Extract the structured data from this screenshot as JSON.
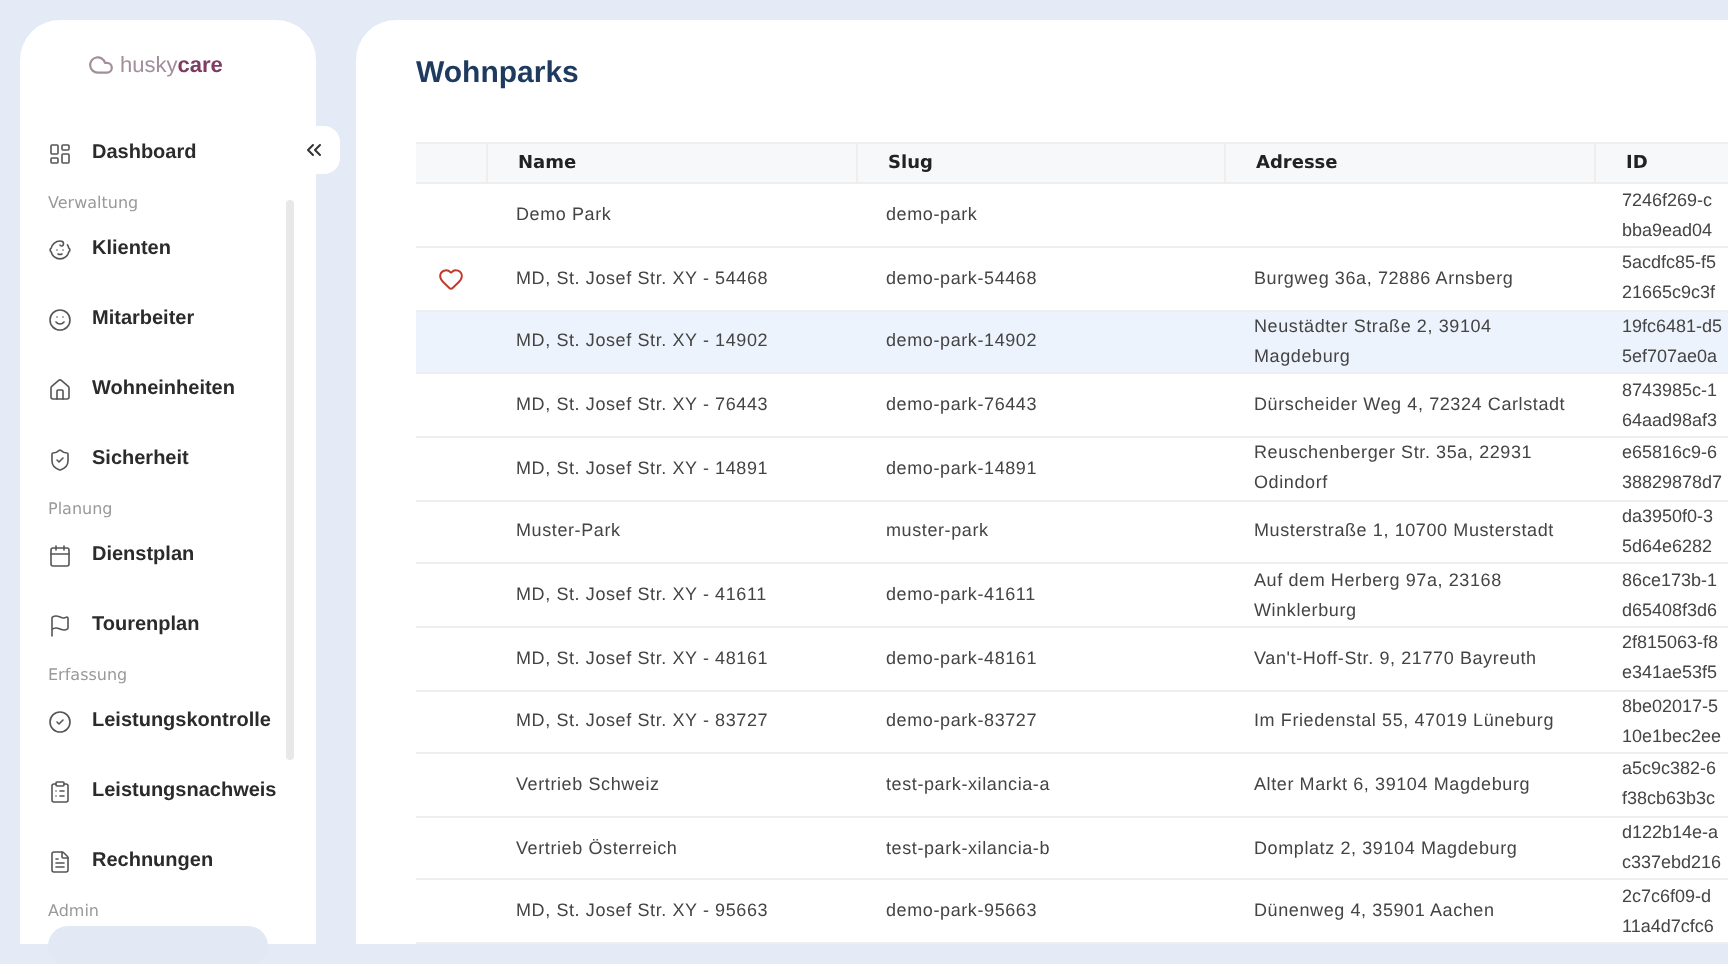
{
  "logo": {
    "text_light": "husky",
    "text_bold": "care"
  },
  "sidebar": {
    "items": [
      {
        "kind": "item",
        "label": "Dashboard",
        "selected": false
      },
      {
        "kind": "section",
        "label": "Verwaltung"
      },
      {
        "kind": "item",
        "label": "Klienten",
        "selected": false
      },
      {
        "kind": "item",
        "label": "Mitarbeiter",
        "selected": false
      },
      {
        "kind": "item",
        "label": "Wohneinheiten",
        "selected": false
      },
      {
        "kind": "item",
        "label": "Sicherheit",
        "selected": false
      },
      {
        "kind": "section",
        "label": "Planung"
      },
      {
        "kind": "item",
        "label": "Dienstplan",
        "selected": false
      },
      {
        "kind": "item",
        "label": "Tourenplan",
        "selected": false
      },
      {
        "kind": "section",
        "label": "Erfassung"
      },
      {
        "kind": "item",
        "label": "Leistungskontrolle",
        "selected": false
      },
      {
        "kind": "item",
        "label": "Leistungsnachweis",
        "selected": false
      },
      {
        "kind": "item",
        "label": "Rechnungen",
        "selected": false
      },
      {
        "kind": "section",
        "label": "Admin"
      },
      {
        "kind": "item",
        "selected": true
      }
    ]
  },
  "page_title": "Wohnparks",
  "table": {
    "columns": [
      "Name",
      "Slug",
      "Adresse",
      "ID"
    ],
    "rows": [
      {
        "favorite": false,
        "selected": false,
        "name": "Demo Park",
        "slug": "demo-park",
        "id": [
          "7246f269-c",
          "bba9ead04"
        ]
      },
      {
        "favorite": true,
        "selected": false,
        "name": "MD, St. Josef Str. XY - 54468",
        "slug": "demo-park-54468",
        "address": "Burgweg 36a, 72886 Arnsberg",
        "id": [
          "5acdfc85-f5",
          "21665c9c3f"
        ]
      },
      {
        "favorite": false,
        "selected": true,
        "name": "MD, St. Josef Str. XY - 14902",
        "slug": "demo-park-14902",
        "address": "Neustädter Straße 2, 39104 Magdeburg",
        "id": [
          "19fc6481-d5",
          "5ef707ae0a"
        ]
      },
      {
        "favorite": false,
        "selected": false,
        "name": "MD, St. Josef Str. XY - 76443",
        "slug": "demo-park-76443",
        "address": "Dürscheider Weg 4, 72324 Carlstadt",
        "id": [
          "8743985c-1",
          "64aad98af3"
        ]
      },
      {
        "favorite": false,
        "selected": false,
        "name": "MD, St. Josef Str. XY - 14891",
        "slug": "demo-park-14891",
        "address": "Reuschenberger Str. 35a, 22931 Odindorf",
        "id": [
          "e65816c9-6",
          "38829878d7"
        ]
      },
      {
        "favorite": false,
        "selected": false,
        "name": "Muster-Park",
        "slug": "muster-park",
        "address": "Musterstraße 1, 10700 Musterstadt",
        "id": [
          "da3950f0-3",
          "5d64e6282"
        ]
      },
      {
        "favorite": false,
        "selected": false,
        "name": "MD, St. Josef Str. XY - 41611",
        "slug": "demo-park-41611",
        "address": "Auf dem Herberg 97a, 23168 Winklerburg",
        "id": [
          "86ce173b-1",
          "d65408f3d6"
        ]
      },
      {
        "favorite": false,
        "selected": false,
        "name": "MD, St. Josef Str. XY - 48161",
        "slug": "demo-park-48161",
        "address": "Van't-Hoff-Str. 9, 21770 Bayreuth",
        "id": [
          "2f815063-f8",
          "e341ae53f5"
        ]
      },
      {
        "favorite": false,
        "selected": false,
        "name": "MD, St. Josef Str. XY - 83727",
        "slug": "demo-park-83727",
        "address": "Im Friedenstal 55, 47019 Lüneburg",
        "id": [
          "8be02017-5",
          "10e1bec2ee"
        ]
      },
      {
        "favorite": false,
        "selected": false,
        "name": "Vertrieb Schweiz",
        "slug": "test-park-xilancia-a",
        "address": "Alter Markt 6, 39104 Magdeburg",
        "id": [
          "a5c9c382-6",
          "f38cb63b3c"
        ]
      },
      {
        "favorite": false,
        "selected": false,
        "name": "Vertrieb Österreich",
        "slug": "test-park-xilancia-b",
        "address": "Domplatz 2, 39104 Magdeburg",
        "id": [
          "d122b14e-a",
          "c337ebd216"
        ]
      },
      {
        "favorite": false,
        "selected": false,
        "name": "MD, St. Josef Str. XY - 95663",
        "slug": "demo-park-95663",
        "address": "Dünenweg 4, 35901 Aachen",
        "id": [
          "2c7c6f09-d",
          "11a4d7cfc6"
        ]
      }
    ]
  }
}
